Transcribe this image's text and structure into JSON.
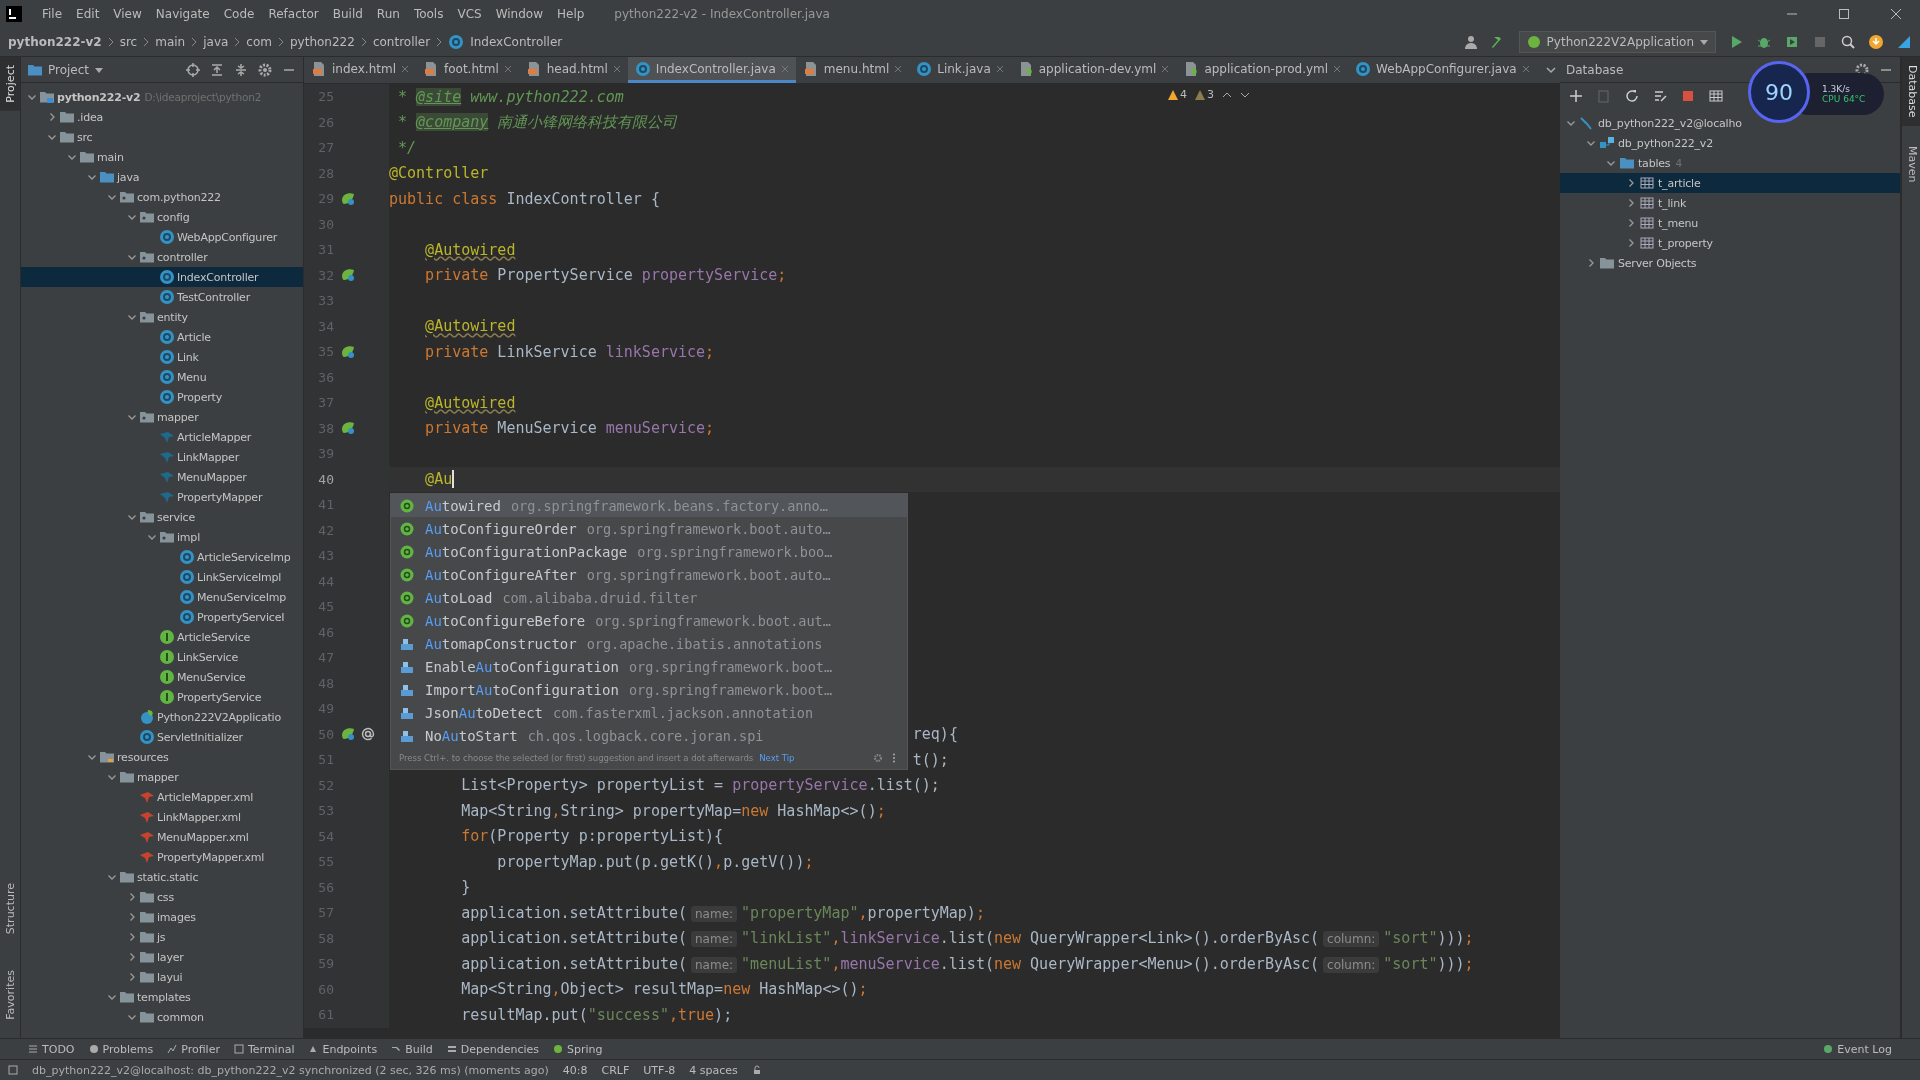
{
  "window": {
    "title": "python222-v2 - IndexController.java"
  },
  "menu": [
    "File",
    "Edit",
    "View",
    "Navigate",
    "Code",
    "Refactor",
    "Build",
    "Run",
    "Tools",
    "VCS",
    "Window",
    "Help"
  ],
  "breadcrumb": [
    "python222-v2",
    "src",
    "main",
    "java",
    "com",
    "python222",
    "controller",
    "IndexController"
  ],
  "run_config": {
    "label": "Python222V2Application"
  },
  "left_stripe": [
    {
      "label": "Project",
      "selected": true
    },
    {
      "label": "Structure",
      "selected": false
    },
    {
      "label": "Favorites",
      "selected": false
    }
  ],
  "right_stripe": [
    {
      "label": "Database",
      "selected": true
    },
    {
      "label": "Maven",
      "selected": false
    }
  ],
  "project": {
    "title": "Project",
    "tree": [
      {
        "label": "python222-v2",
        "kind": "module",
        "note": "D:\\ideaproject\\python2",
        "expanded": true,
        "selected": false,
        "children": [
          {
            "label": ".idea",
            "kind": "folder",
            "expanded": false,
            "selected": false
          },
          {
            "label": "src",
            "kind": "folder",
            "expanded": true,
            "selected": false,
            "children": [
              {
                "label": "main",
                "kind": "folder",
                "expanded": true,
                "selected": false,
                "children": [
                  {
                    "label": "java",
                    "kind": "source",
                    "expanded": true,
                    "selected": false,
                    "children": [
                      {
                        "label": "com.python222",
                        "kind": "package",
                        "expanded": true,
                        "selected": false,
                        "children": [
                          {
                            "label": "config",
                            "kind": "package",
                            "expanded": true,
                            "selected": false,
                            "children": [
                              {
                                "label": "WebAppConfigurer",
                                "kind": "class",
                                "selected": false
                              }
                            ]
                          },
                          {
                            "label": "controller",
                            "kind": "package",
                            "expanded": true,
                            "selected": false,
                            "children": [
                              {
                                "label": "IndexController",
                                "kind": "class",
                                "selected": true
                              },
                              {
                                "label": "TestController",
                                "kind": "class",
                                "selected": false
                              }
                            ]
                          },
                          {
                            "label": "entity",
                            "kind": "package",
                            "expanded": true,
                            "selected": false,
                            "children": [
                              {
                                "label": "Article",
                                "kind": "class",
                                "selected": false
                              },
                              {
                                "label": "Link",
                                "kind": "class",
                                "selected": false
                              },
                              {
                                "label": "Menu",
                                "kind": "class",
                                "selected": false
                              },
                              {
                                "label": "Property",
                                "kind": "class",
                                "selected": false
                              }
                            ]
                          },
                          {
                            "label": "mapper",
                            "kind": "package",
                            "expanded": true,
                            "selected": false,
                            "children": [
                              {
                                "label": "ArticleMapper",
                                "kind": "mapper",
                                "selected": false
                              },
                              {
                                "label": "LinkMapper",
                                "kind": "mapper",
                                "selected": false
                              },
                              {
                                "label": "MenuMapper",
                                "kind": "mapper",
                                "selected": false
                              },
                              {
                                "label": "PropertyMapper",
                                "kind": "mapper",
                                "selected": false
                              }
                            ]
                          },
                          {
                            "label": "service",
                            "kind": "package",
                            "expanded": true,
                            "selected": false,
                            "children": [
                              {
                                "label": "impl",
                                "kind": "package",
                                "expanded": true,
                                "selected": false,
                                "children": [
                                  {
                                    "label": "ArticleServiceImp",
                                    "kind": "class",
                                    "selected": false
                                  },
                                  {
                                    "label": "LinkServiceImpl",
                                    "kind": "class",
                                    "selected": false
                                  },
                                  {
                                    "label": "MenuServiceImp",
                                    "kind": "class",
                                    "selected": false
                                  },
                                  {
                                    "label": "PropertyServiceI",
                                    "kind": "class",
                                    "selected": false
                                  }
                                ]
                              },
                              {
                                "label": "ArticleService",
                                "kind": "interface",
                                "selected": false
                              },
                              {
                                "label": "LinkService",
                                "kind": "interface",
                                "selected": false
                              },
                              {
                                "label": "MenuService",
                                "kind": "interface",
                                "selected": false
                              },
                              {
                                "label": "PropertyService",
                                "kind": "interface",
                                "selected": false
                              }
                            ]
                          },
                          {
                            "label": "Python222V2Applicatio",
                            "kind": "springboot",
                            "selected": false
                          },
                          {
                            "label": "ServletInitializer",
                            "kind": "class",
                            "selected": false
                          }
                        ]
                      }
                    ]
                  },
                  {
                    "label": "resources",
                    "kind": "resources",
                    "expanded": true,
                    "selected": false,
                    "children": [
                      {
                        "label": "mapper",
                        "kind": "folder",
                        "expanded": true,
                        "selected": false,
                        "children": [
                          {
                            "label": "ArticleMapper.xml",
                            "kind": "xml",
                            "selected": false
                          },
                          {
                            "label": "LinkMapper.xml",
                            "kind": "xml",
                            "selected": false
                          },
                          {
                            "label": "MenuMapper.xml",
                            "kind": "xml",
                            "selected": false
                          },
                          {
                            "label": "PropertyMapper.xml",
                            "kind": "xml",
                            "selected": false
                          }
                        ]
                      },
                      {
                        "label": "static.static",
                        "kind": "folder",
                        "expanded": true,
                        "selected": false,
                        "children": [
                          {
                            "label": "css",
                            "kind": "folder",
                            "expanded": false,
                            "selected": false
                          },
                          {
                            "label": "images",
                            "kind": "folder",
                            "expanded": false,
                            "selected": false
                          },
                          {
                            "label": "js",
                            "kind": "folder",
                            "expanded": false,
                            "selected": false
                          },
                          {
                            "label": "layer",
                            "kind": "folder",
                            "expanded": false,
                            "selected": false
                          },
                          {
                            "label": "layui",
                            "kind": "folder",
                            "expanded": false,
                            "selected": false
                          }
                        ]
                      },
                      {
                        "label": "templates",
                        "kind": "folder",
                        "expanded": true,
                        "selected": false,
                        "children": [
                          {
                            "label": "common",
                            "kind": "folder",
                            "expanded": true,
                            "selected": false
                          }
                        ]
                      }
                    ]
                  }
                ]
              }
            ]
          }
        ]
      }
    ]
  },
  "editor": {
    "tabs": [
      {
        "label": "index.html",
        "kind": "html",
        "selected": false
      },
      {
        "label": "foot.html",
        "kind": "html",
        "selected": false
      },
      {
        "label": "head.html",
        "kind": "html",
        "selected": false
      },
      {
        "label": "IndexController.java",
        "kind": "class",
        "selected": true
      },
      {
        "label": "menu.html",
        "kind": "html",
        "selected": false
      },
      {
        "label": "Link.java",
        "kind": "class",
        "selected": false
      },
      {
        "label": "application-dev.yml",
        "kind": "yml",
        "selected": false
      },
      {
        "label": "application-prod.yml",
        "kind": "yml",
        "selected": false
      },
      {
        "label": "WebAppConfigurer.java",
        "kind": "class",
        "selected": false
      }
    ],
    "inspections": [
      {
        "kind": "warning",
        "count": "4"
      },
      {
        "kind": "weak",
        "count": "3"
      }
    ],
    "lines": [
      {
        "num": "25",
        "tokens": [
          {
            "t": " * ",
            "kind": "doc"
          },
          {
            "t": "@site",
            "kind": "doctag"
          },
          {
            "t": " www.python222.com",
            "kind": "doc"
          }
        ]
      },
      {
        "num": "26",
        "tokens": [
          {
            "t": " * ",
            "kind": "doc"
          },
          {
            "t": "@company",
            "kind": "doctag"
          },
          {
            "t": " 南通小锋网络科技有限公司",
            "kind": "doc"
          }
        ]
      },
      {
        "num": "27",
        "tokens": [
          {
            "t": " */",
            "kind": "doc"
          }
        ]
      },
      {
        "num": "28",
        "tokens": [
          {
            "t": "@Controller",
            "kind": "annotation"
          }
        ]
      },
      {
        "num": "29",
        "gutter": [
          {
            "kind": "bean"
          }
        ],
        "tokens": [
          {
            "t": "public class ",
            "kind": "keyword"
          },
          {
            "t": "IndexController {",
            "kind": "plain"
          }
        ]
      },
      {
        "num": "30"
      },
      {
        "num": "31",
        "tokens": [
          {
            "t": "    @Autowired",
            "kind": "warned"
          }
        ]
      },
      {
        "num": "32",
        "gutter": [
          {
            "kind": "bean"
          }
        ],
        "tokens": [
          {
            "t": "    private ",
            "kind": "keyword"
          },
          {
            "t": "PropertyService ",
            "kind": "plain"
          },
          {
            "t": "propertyService",
            "kind": "field"
          },
          {
            "t": ";",
            "kind": "keyword"
          }
        ]
      },
      {
        "num": "33"
      },
      {
        "num": "34",
        "tokens": [
          {
            "t": "    @Autowired",
            "kind": "warned"
          }
        ]
      },
      {
        "num": "35",
        "gutter": [
          {
            "kind": "bean"
          }
        ],
        "tokens": [
          {
            "t": "    private ",
            "kind": "keyword"
          },
          {
            "t": "LinkService ",
            "kind": "plain"
          },
          {
            "t": "linkService",
            "kind": "field"
          },
          {
            "t": ";",
            "kind": "keyword"
          }
        ]
      },
      {
        "num": "36"
      },
      {
        "num": "37",
        "tokens": [
          {
            "t": "    @Autowired",
            "kind": "warned"
          }
        ]
      },
      {
        "num": "38",
        "gutter": [
          {
            "kind": "bean"
          }
        ],
        "tokens": [
          {
            "t": "    private ",
            "kind": "keyword"
          },
          {
            "t": "MenuService ",
            "kind": "plain"
          },
          {
            "t": "menuService",
            "kind": "field"
          },
          {
            "t": ";",
            "kind": "keyword"
          }
        ]
      },
      {
        "num": "39"
      },
      {
        "num": "40",
        "current": true,
        "tokens": [
          {
            "t": "    @Au",
            "kind": "annotation"
          }
        ]
      },
      {
        "num": "41"
      },
      {
        "num": "42"
      },
      {
        "num": "43"
      },
      {
        "num": "44"
      },
      {
        "num": "45"
      },
      {
        "num": "46"
      },
      {
        "num": "47"
      },
      {
        "num": "48"
      },
      {
        "num": "49"
      },
      {
        "num": "50",
        "gutter": [
          {
            "kind": "bean"
          },
          {
            "kind": "at"
          }
        ],
        "tokens": [
          {
            "t": "                                                          req){",
            "kind": "plain"
          }
        ]
      },
      {
        "num": "51",
        "tokens": [
          {
            "t": "                                                          t();",
            "kind": "plain"
          }
        ]
      },
      {
        "num": "52",
        "tokens": [
          {
            "t": "        List<Property> propertyList = ",
            "kind": "plain"
          },
          {
            "t": "propertyService",
            "kind": "field"
          },
          {
            "t": ".list();",
            "kind": "plain"
          }
        ]
      },
      {
        "num": "53",
        "tokens": [
          {
            "t": "        Map<String",
            "kind": "plain"
          },
          {
            "t": ",",
            "kind": "keyword"
          },
          {
            "t": "String> propertyMap=",
            "kind": "plain"
          },
          {
            "t": "new ",
            "kind": "keyword"
          },
          {
            "t": "HashMap<>()",
            "kind": "plain"
          },
          {
            "t": ";",
            "kind": "keyword"
          }
        ]
      },
      {
        "num": "54",
        "tokens": [
          {
            "t": "        for",
            "kind": "keyword"
          },
          {
            "t": "(Property p:propertyList){",
            "kind": "plain"
          }
        ]
      },
      {
        "num": "55",
        "tokens": [
          {
            "t": "            propertyMap.put(p.getK()",
            "kind": "plain"
          },
          {
            "t": ",",
            "kind": "keyword"
          },
          {
            "t": "p.getV())",
            "kind": "plain"
          },
          {
            "t": ";",
            "kind": "keyword"
          }
        ]
      },
      {
        "num": "56",
        "tokens": [
          {
            "t": "        }",
            "kind": "plain"
          }
        ]
      },
      {
        "num": "57",
        "tokens": [
          {
            "t": "        application.setAttribute(",
            "kind": "plain"
          },
          {
            "t": "name:",
            "kind": "hint"
          },
          {
            "t": "\"propertyMap\"",
            "kind": "string"
          },
          {
            "t": ",",
            "kind": "keyword"
          },
          {
            "t": "propertyMap)",
            "kind": "plain"
          },
          {
            "t": ";",
            "kind": "keyword"
          }
        ]
      },
      {
        "num": "58",
        "tokens": [
          {
            "t": "        application.setAttribute(",
            "kind": "plain"
          },
          {
            "t": "name:",
            "kind": "hint"
          },
          {
            "t": "\"linkList\"",
            "kind": "string"
          },
          {
            "t": ",",
            "kind": "keyword"
          },
          {
            "t": "linkService",
            "kind": "field"
          },
          {
            "t": ".list(",
            "kind": "plain"
          },
          {
            "t": "new ",
            "kind": "keyword"
          },
          {
            "t": "QueryWrapper<Link>().orderByAsc(",
            "kind": "plain"
          },
          {
            "t": "column:",
            "kind": "hint"
          },
          {
            "t": "\"sort\"",
            "kind": "string"
          },
          {
            "t": ")))",
            "kind": "plain"
          },
          {
            "t": ";",
            "kind": "keyword"
          }
        ]
      },
      {
        "num": "59",
        "tokens": [
          {
            "t": "        application.setAttribute(",
            "kind": "plain"
          },
          {
            "t": "name:",
            "kind": "hint"
          },
          {
            "t": "\"menuList\"",
            "kind": "string"
          },
          {
            "t": ",",
            "kind": "keyword"
          },
          {
            "t": "menuService",
            "kind": "field"
          },
          {
            "t": ".list(",
            "kind": "plain"
          },
          {
            "t": "new ",
            "kind": "keyword"
          },
          {
            "t": "QueryWrapper<Menu>().orderByAsc(",
            "kind": "plain"
          },
          {
            "t": "column:",
            "kind": "hint"
          },
          {
            "t": "\"sort\"",
            "kind": "string"
          },
          {
            "t": ")))",
            "kind": "plain"
          },
          {
            "t": ";",
            "kind": "keyword"
          }
        ]
      },
      {
        "num": "60",
        "tokens": [
          {
            "t": "        Map<String",
            "kind": "plain"
          },
          {
            "t": ",",
            "kind": "keyword"
          },
          {
            "t": "Object> resultMap=",
            "kind": "plain"
          },
          {
            "t": "new ",
            "kind": "keyword"
          },
          {
            "t": "HashMap<>()",
            "kind": "plain"
          },
          {
            "t": ";",
            "kind": "keyword"
          }
        ]
      },
      {
        "num": "61",
        "tokens": [
          {
            "t": "        resultMap.put(",
            "kind": "plain"
          },
          {
            "t": "\"success\"",
            "kind": "string"
          },
          {
            "t": ",",
            "kind": "keyword"
          },
          {
            "t": "true",
            "kind": "keyword"
          },
          {
            "t": ");",
            "kind": "plain"
          }
        ]
      }
    ],
    "completion": {
      "items": [
        {
          "match": "Au",
          "after": "towired",
          "package": "org.springframework.beans.factory.anno…",
          "kind": "annotation",
          "selected": true
        },
        {
          "match": "Au",
          "after": "toConfigureOrder",
          "package": "org.springframework.boot.auto…",
          "kind": "annotation",
          "selected": false
        },
        {
          "match": "Au",
          "after": "toConfigurationPackage",
          "package": "org.springframework.boo…",
          "kind": "annotation",
          "selected": false
        },
        {
          "match": "Au",
          "after": "toConfigureAfter",
          "package": "org.springframework.boot.auto…",
          "kind": "annotation",
          "selected": false
        },
        {
          "match": "Au",
          "after": "toLoad",
          "package": "com.alibaba.druid.filter",
          "kind": "annotation",
          "selected": false
        },
        {
          "match": "Au",
          "after": "toConfigureBefore",
          "package": "org.springframework.boot.aut…",
          "kind": "annotation",
          "selected": false
        },
        {
          "match": "Au",
          "after": "tomapConstructor",
          "package": "org.apache.ibatis.annotations",
          "kind": "library",
          "selected": false
        },
        {
          "before": "Enable",
          "match": "Au",
          "after": "toConfiguration",
          "package": "org.springframework.boot…",
          "kind": "library",
          "selected": false
        },
        {
          "before": "Import",
          "match": "Au",
          "after": "toConfiguration",
          "package": "org.springframework.boot…",
          "kind": "library",
          "selected": false
        },
        {
          "before": "Json",
          "match": "Au",
          "after": "toDetect",
          "package": "com.fasterxml.jackson.annotation",
          "kind": "library",
          "selected": false
        },
        {
          "before": "No",
          "match": "Au",
          "after": "toStart",
          "package": "ch.qos.logback.core.joran.spi",
          "kind": "library",
          "selected": false
        }
      ],
      "hint": "Press Ctrl+. to choose the selected (or first) suggestion and insert a dot afterwards",
      "next_tip": "Next Tip"
    }
  },
  "database": {
    "title": "Database",
    "tree": [
      {
        "label": "db_python222_v2@localho",
        "kind": "datasource",
        "expanded": true,
        "selected": false,
        "children": [
          {
            "label": "db_python222_v2",
            "kind": "schema",
            "expanded": true,
            "selected": false,
            "children": [
              {
                "label": "tables",
                "kind": "folder",
                "count": "4",
                "expanded": true,
                "selected": false,
                "children": [
                  {
                    "label": "t_article",
                    "kind": "table",
                    "expanded": false,
                    "selected": true
                  },
                  {
                    "label": "t_link",
                    "kind": "table",
                    "expanded": false,
                    "selected": false
                  },
                  {
                    "label": "t_menu",
                    "kind": "table",
                    "expanded": false,
                    "selected": false
                  },
                  {
                    "label": "t_property",
                    "kind": "table",
                    "expanded": false,
                    "selected": false
                  }
                ]
              }
            ]
          },
          {
            "label": "Server Objects",
            "kind": "folder",
            "expanded": false,
            "selected": false
          }
        ]
      }
    ]
  },
  "monitor": {
    "value": "90",
    "speed": "1.3K/s",
    "cpu": "CPU 64°C"
  },
  "tool_windows": [
    {
      "label": "TODO",
      "kind": "todo"
    },
    {
      "label": "Problems",
      "kind": "problems"
    },
    {
      "label": "Profiler",
      "kind": "profiler"
    },
    {
      "label": "Terminal",
      "kind": "terminal"
    },
    {
      "label": "Endpoints",
      "kind": "endpoints"
    },
    {
      "label": "Build",
      "kind": "build"
    },
    {
      "label": "Dependencies",
      "kind": "dependencies"
    },
    {
      "label": "Spring",
      "kind": "spring"
    }
  ],
  "event_log": "Event Log",
  "status": {
    "message": "db_python222_v2@localhost: db_python222_v2 synchronized (2 sec, 326 ms) (moments ago)",
    "items": [
      "40:8",
      "CRLF",
      "UTF-8",
      "4 spaces"
    ]
  }
}
